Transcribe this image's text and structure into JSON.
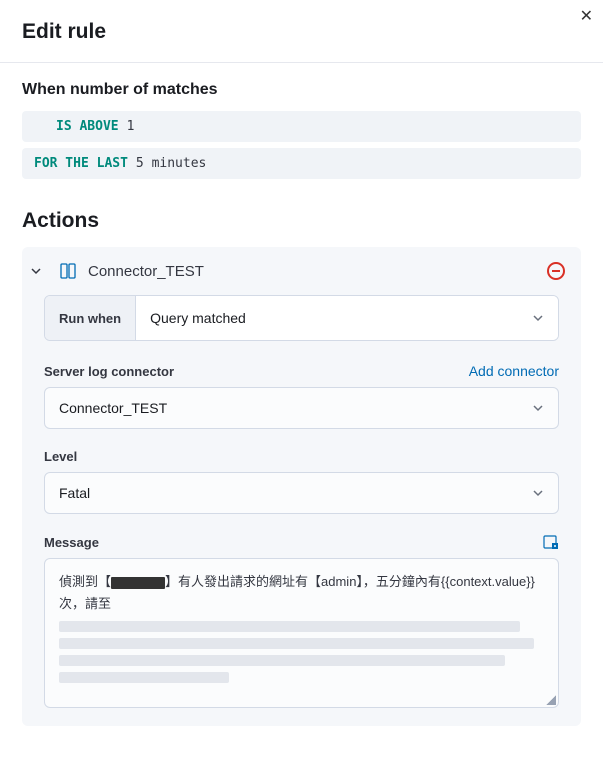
{
  "header": {
    "title": "Edit rule"
  },
  "condition": {
    "heading": "When number of matches",
    "row1_kw": "IS ABOVE",
    "row1_val": "1",
    "row2_kw": "FOR THE LAST",
    "row2_val": "5 minutes"
  },
  "actions": {
    "heading": "Actions",
    "items": [
      {
        "name": "Connector_TEST",
        "run_when_label": "Run when",
        "run_when_value": "Query matched",
        "connector_label": "Server log connector",
        "add_connector_link": "Add connector",
        "connector_value": "Connector_TEST",
        "level_label": "Level",
        "level_value": "Fatal",
        "message_label": "Message",
        "message_prefix": "偵測到【",
        "message_mid": "】有人發出請求的網址有【admin】，五分鐘內有{{context.value}}次，請至"
      }
    ]
  }
}
